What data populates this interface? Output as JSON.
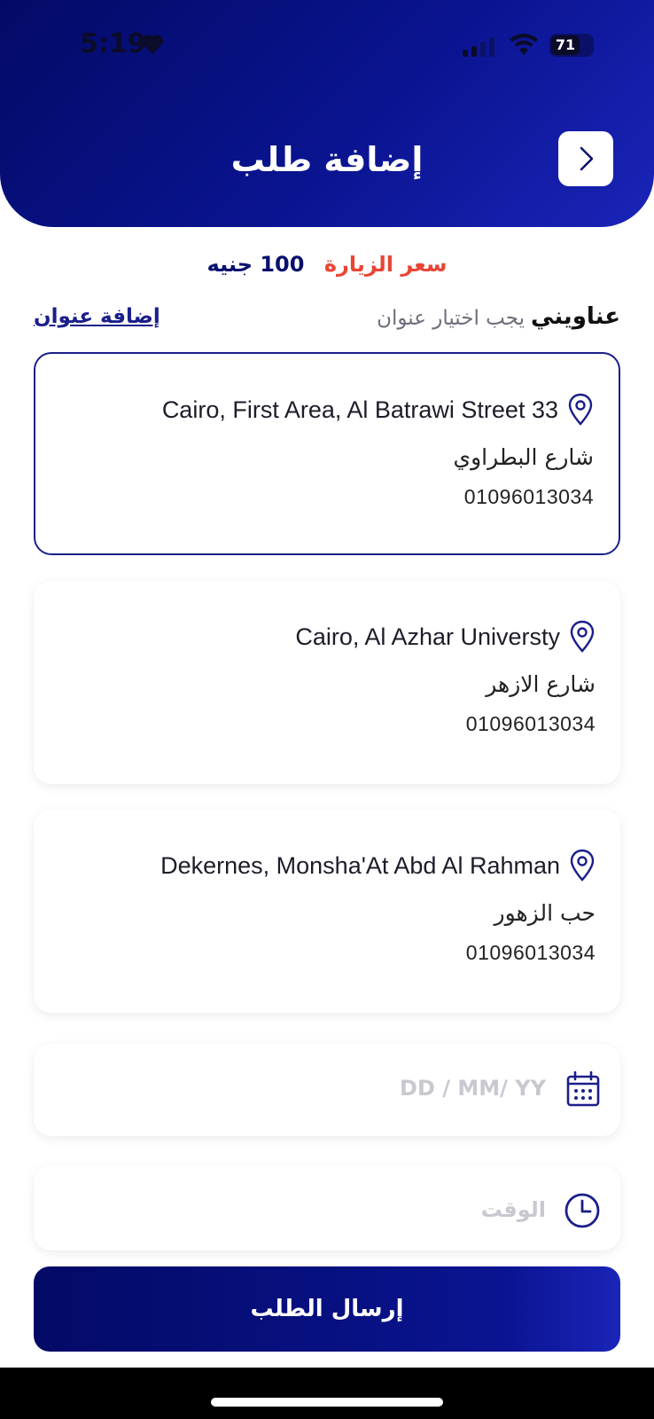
{
  "status_bar": {
    "time": "5:19",
    "battery": "71"
  },
  "header": {
    "title": "إضافة طلب"
  },
  "price": {
    "label": "سعر الزيارة",
    "value": "100 جنيه"
  },
  "addresses": {
    "title": "عناويني",
    "hint": "يجب اختيار عنوان",
    "add_label": "إضافة عنوان",
    "items": [
      {
        "line1": "Cairo, First Area, Al Batrawi Street 33",
        "street": "شارع البطراوي",
        "phone": "01096013034",
        "selected": true
      },
      {
        "line1": "Cairo, Al Azhar Universty",
        "street": "شارع الازهر",
        "phone": "01096013034",
        "selected": false
      },
      {
        "line1": "Dekernes, Monsha'At Abd Al Rahman",
        "street": "حب الزهور",
        "phone": "01096013034",
        "selected": false
      }
    ]
  },
  "date_field": {
    "placeholder": "DD / MM/ YY"
  },
  "time_field": {
    "placeholder": "الوقت"
  },
  "submit": {
    "label": "إرسال الطلب"
  },
  "colors": {
    "primary": "#08106e",
    "accent_red": "#e84535",
    "border_selected": "#1a1f8a"
  }
}
